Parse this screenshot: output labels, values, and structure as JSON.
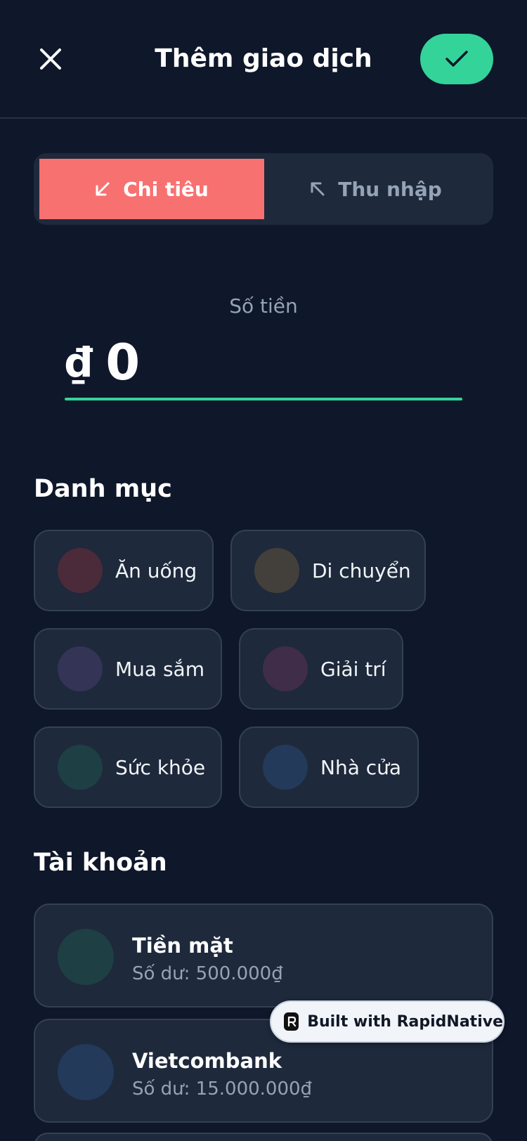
{
  "header": {
    "title": "Thêm giao dịch"
  },
  "type_toggle": {
    "expense_label": "Chi tiêu",
    "income_label": "Thu nhập",
    "selected": "expense"
  },
  "amount": {
    "label": "Số tiền",
    "currency": "₫",
    "value": "0"
  },
  "categories": {
    "title": "Danh mục",
    "items": [
      {
        "label": "Ăn uống",
        "color": "#4b2a3a"
      },
      {
        "label": "Di chuyển",
        "color": "#43403c"
      },
      {
        "label": "Mua sắm",
        "color": "#333456"
      },
      {
        "label": "Giải trí",
        "color": "#402d4a"
      },
      {
        "label": "Sức khỏe",
        "color": "#1e3f43"
      },
      {
        "label": "Nhà cửa",
        "color": "#243a5a"
      }
    ]
  },
  "accounts": {
    "title": "Tài khoản",
    "items": [
      {
        "name": "Tiền mặt",
        "balance": "Số dư: 500.000₫",
        "color": "#1e3f43"
      },
      {
        "name": "Vietcombank",
        "balance": "Số dư: 15.000.000₫",
        "color": "#243a5a"
      }
    ]
  },
  "badge": {
    "text": "Built with RapidNative"
  },
  "colors": {
    "background": "#0f172a",
    "surface": "#1e293b",
    "accent": "#34d399",
    "expense": "#f87171",
    "muted": "#94a3b8"
  }
}
